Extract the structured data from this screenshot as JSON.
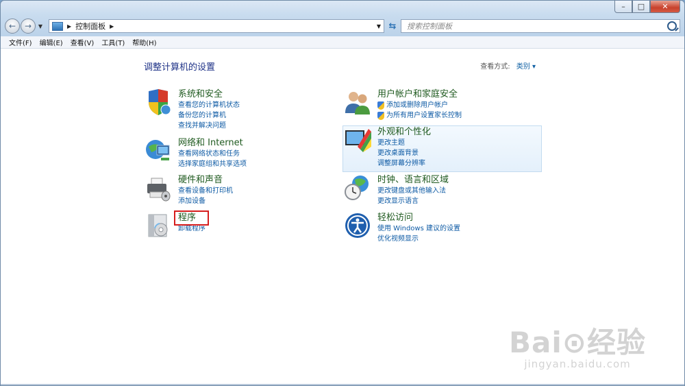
{
  "window": {
    "caption": {
      "minimize": "–",
      "maximize": "□",
      "close": "✕"
    }
  },
  "nav": {
    "back_glyph": "←",
    "forward_glyph": "→",
    "address_separator": "▶",
    "address_text": "控制面板",
    "address_trailing": "▶",
    "dropdown_glyph": "▼",
    "refresh_glyph": "⇆",
    "search_placeholder": "搜索控制面板"
  },
  "menu": [
    "文件(F)",
    "编辑(E)",
    "查看(V)",
    "工具(T)",
    "帮助(H)"
  ],
  "content": {
    "title": "调整计算机的设置",
    "view_by_label": "查看方式:",
    "view_by_value": "类别 ▾"
  },
  "categories": [
    {
      "title": "系统和安全",
      "icon": "shield-icon",
      "links": [
        "查看您的计算机状态",
        "备份您的计算机",
        "查找并解决问题"
      ]
    },
    {
      "title": "网络和 Internet",
      "icon": "network-icon",
      "links": [
        "查看网络状态和任务",
        "选择家庭组和共享选项"
      ]
    },
    {
      "title": "硬件和声音",
      "icon": "printer-icon",
      "links": [
        "查看设备和打印机",
        "添加设备"
      ]
    },
    {
      "title": "程序",
      "icon": "programs-icon",
      "links": [
        "卸载程序"
      ]
    },
    {
      "title": "用户帐户和家庭安全",
      "icon": "users-icon",
      "links": [
        "添加或删除用户帐户",
        "为所有用户设置家长控制"
      ]
    },
    {
      "title": "外观和个性化",
      "icon": "appearance-icon",
      "links": [
        "更改主题",
        "更改桌面背景",
        "调整屏幕分辨率"
      ]
    },
    {
      "title": "时钟、语言和区域",
      "icon": "clock-globe-icon",
      "links": [
        "更改键盘或其他输入法",
        "更改显示语言"
      ]
    },
    {
      "title": "轻松访问",
      "icon": "ease-of-access-icon",
      "links": [
        "使用 Windows 建议的设置",
        "优化视频显示"
      ]
    }
  ],
  "watermark": {
    "main": "Bai⊙经验",
    "sub": "jingyan.baidu.com"
  },
  "colors": {
    "title": "#1f5a1f",
    "link": "#0d5aa4",
    "highlight_border": "#d61c1c"
  }
}
